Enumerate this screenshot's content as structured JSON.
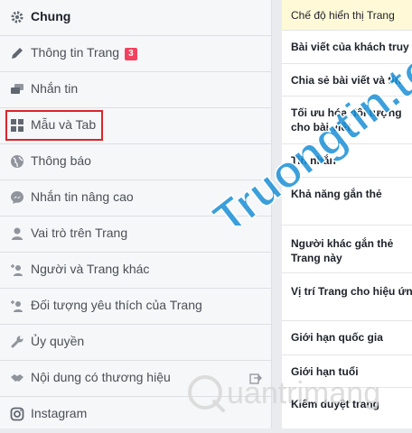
{
  "sidebar": {
    "items": [
      {
        "label": "Chung",
        "icon": "gear-icon"
      },
      {
        "label": "Thông tin Trang",
        "icon": "pencil-icon",
        "badge": "3"
      },
      {
        "label": "Nhắn tin",
        "icon": "chat-bubbles-icon"
      },
      {
        "label": "Mẫu và Tab",
        "icon": "grid-icon"
      },
      {
        "label": "Thông báo",
        "icon": "globe-icon"
      },
      {
        "label": "Nhắn tin nâng cao",
        "icon": "messenger-icon"
      },
      {
        "label": "Vai trò trên Trang",
        "icon": "person-icon"
      },
      {
        "label": "Người và Trang khác",
        "icon": "person-plus-icon"
      },
      {
        "label": "Đối tượng yêu thích của Trang",
        "icon": "person-plus-icon"
      },
      {
        "label": "Ủy quyền",
        "icon": "wrench-icon"
      },
      {
        "label": "Nội dung có thương hiệu",
        "icon": "handshake-icon"
      },
      {
        "label": "Instagram",
        "icon": "instagram-icon"
      }
    ]
  },
  "settings": {
    "rows": [
      {
        "label": "Chế độ hiển thị Trang"
      },
      {
        "label": "Bài viết của khách truy cập"
      },
      {
        "label": "Chia sẻ bài viết và tin"
      },
      {
        "label": "Tối ưu hóa đối tượng cho bài viết"
      },
      {
        "label": "Tin nhắn"
      },
      {
        "label": "Khả năng gắn thẻ"
      },
      {
        "label": "Người khác gắn thẻ Trang này"
      },
      {
        "label": "Vị trí Trang cho hiệu ứng"
      },
      {
        "label": "Giới hạn quốc gia"
      },
      {
        "label": "Giới hạn tuổi"
      },
      {
        "label": "Kiểm duyệt trang"
      }
    ]
  },
  "watermark": {
    "text1": "Truongtin.top",
    "text2": "uantrimang"
  },
  "colors": {
    "sidebar_bg": "#f6f7f9",
    "highlight_row": "#fff9d7",
    "red_box": "#d9252b",
    "watermark_blue": "#1a8fd6",
    "watermark_orange": "#f57c1f"
  }
}
